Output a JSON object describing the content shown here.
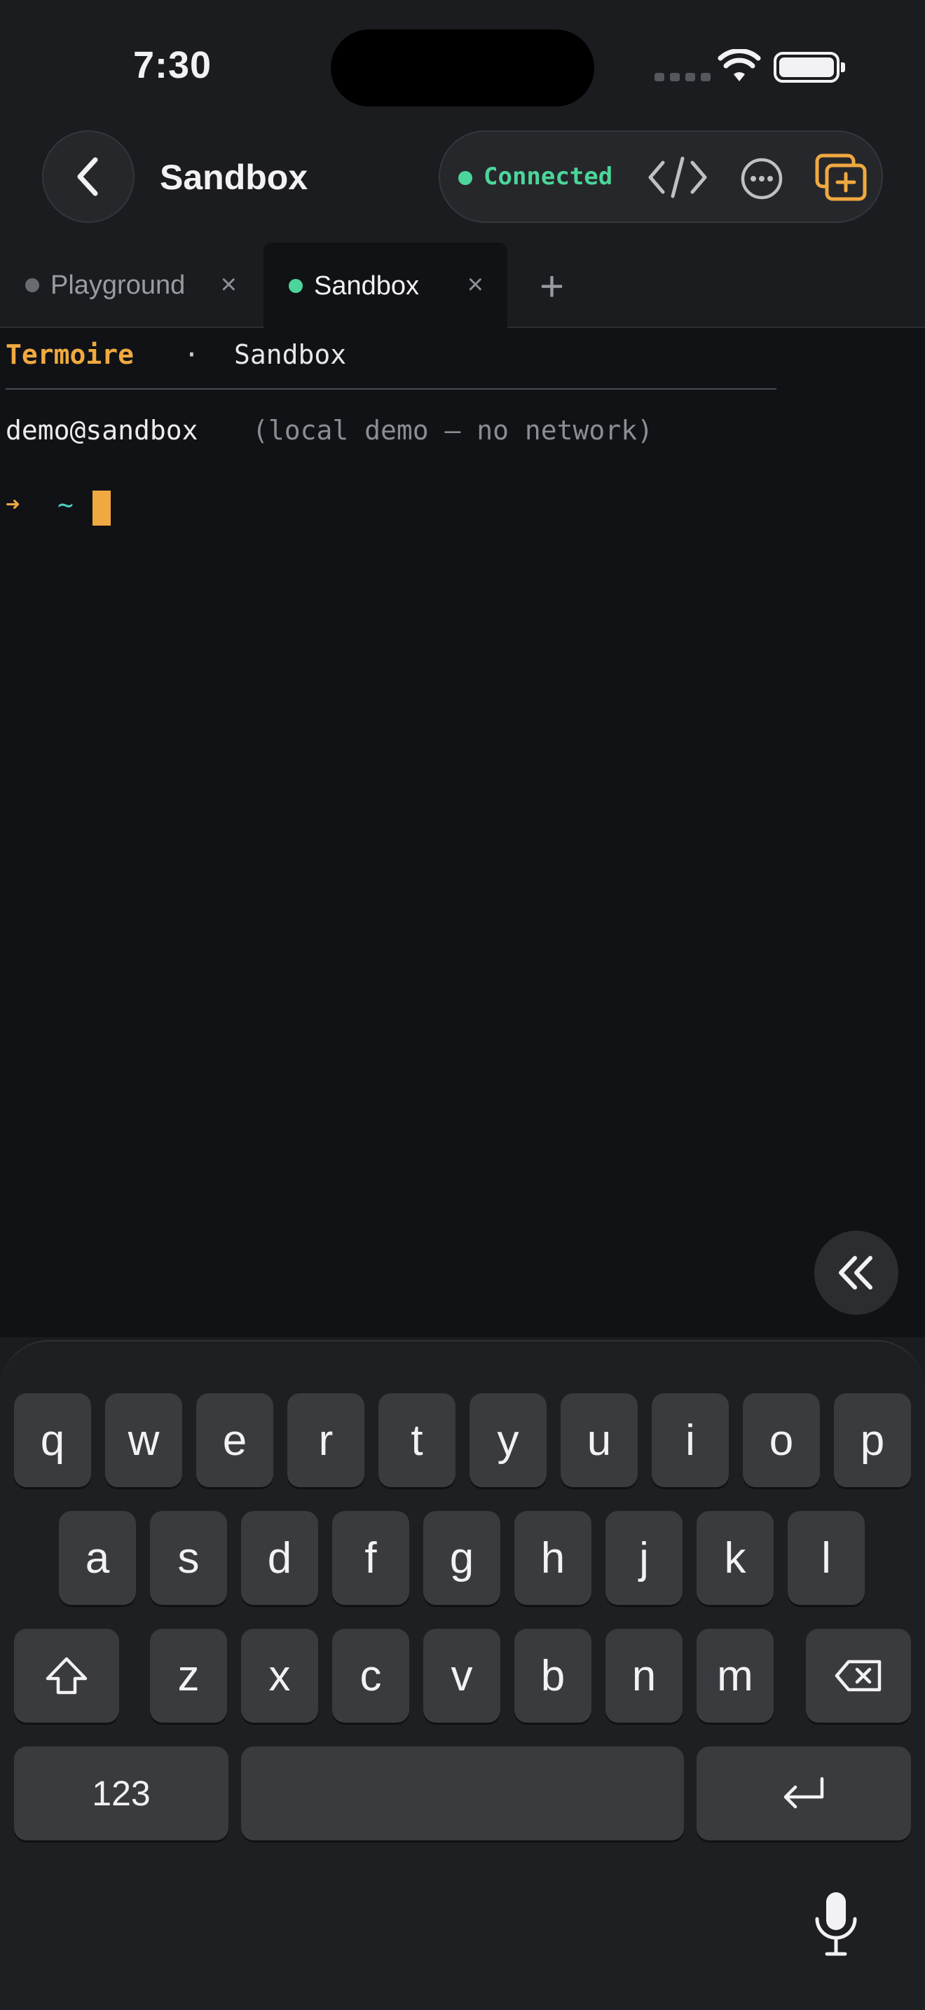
{
  "status_bar": {
    "time": "7:30"
  },
  "header": {
    "title": "Sandbox"
  },
  "connection": {
    "label": "Connected",
    "color": "#4cd59a"
  },
  "tabs": [
    {
      "label": "Playground",
      "active": false
    },
    {
      "label": "Sandbox",
      "active": true
    }
  ],
  "tab_close_glyph": "×",
  "add_tab_glyph": "+",
  "terminal": {
    "brand": "Termoire",
    "separator": "·",
    "session": "Sandbox",
    "user": "demo@sandbox",
    "note": "(local demo — no network)",
    "prompt_arrow": "➜",
    "cwd": "~"
  },
  "keyboard": {
    "row1": [
      "q",
      "w",
      "e",
      "r",
      "t",
      "y",
      "u",
      "i",
      "o",
      "p"
    ],
    "row2": [
      "a",
      "s",
      "d",
      "f",
      "g",
      "h",
      "j",
      "k",
      "l"
    ],
    "row3": [
      "z",
      "x",
      "c",
      "v",
      "b",
      "n",
      "m"
    ],
    "numbers_label": "123"
  },
  "colors": {
    "accent": "#f0a940",
    "terminal_bg": "#111215",
    "cwd": "#4fd0c4"
  },
  "icons": [
    "wifi-icon",
    "battery-icon",
    "back-chevron-icon",
    "code-icon",
    "more-icon",
    "new-tab-icon",
    "collapse-icon",
    "shift-icon",
    "delete-icon",
    "return-icon",
    "microphone-icon"
  ]
}
